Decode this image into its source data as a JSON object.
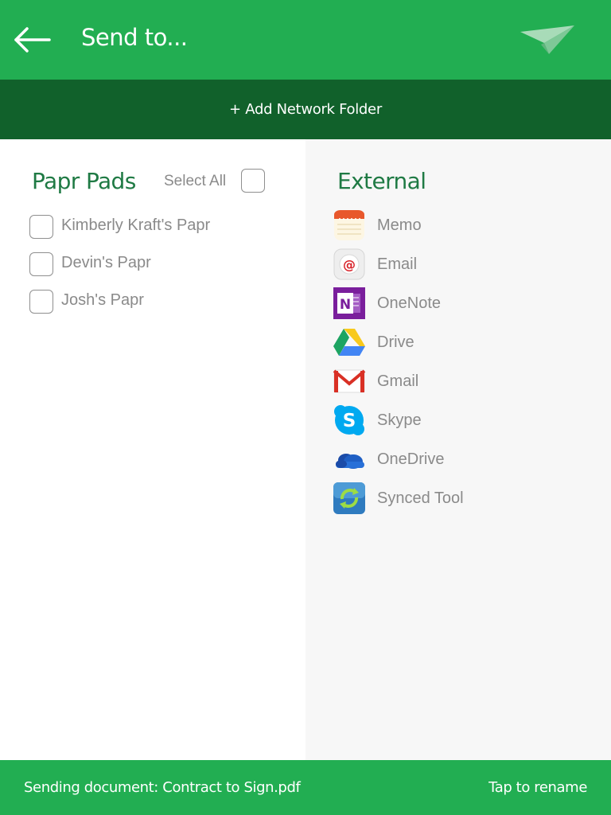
{
  "header": {
    "title": "Send to...",
    "back_icon": "arrow-left-icon",
    "send_icon": "paper-plane-icon",
    "bg_color": "#22ae52"
  },
  "add_network_folder": {
    "label": "+ Add Network Folder",
    "bg_color": "#11612b"
  },
  "papr_pads": {
    "title": "Papr Pads",
    "select_all_label": "Select All",
    "select_all_checked": false,
    "items": [
      {
        "label": "Kimberly Kraft's Papr",
        "checked": false
      },
      {
        "label": "Devin's Papr",
        "checked": false
      },
      {
        "label": "Josh's Papr",
        "checked": false
      }
    ]
  },
  "external": {
    "title": "External",
    "items": [
      {
        "label": "Memo",
        "icon": "memo-notepad-icon"
      },
      {
        "label": "Email",
        "icon": "email-at-icon"
      },
      {
        "label": "OneNote",
        "icon": "onenote-icon"
      },
      {
        "label": "Drive",
        "icon": "google-drive-icon"
      },
      {
        "label": "Gmail",
        "icon": "gmail-icon"
      },
      {
        "label": "Skype",
        "icon": "skype-icon"
      },
      {
        "label": "OneDrive",
        "icon": "onedrive-cloud-icon"
      },
      {
        "label": "Synced Tool",
        "icon": "sync-arrows-icon"
      }
    ]
  },
  "footer": {
    "status": "Sending document: Contract to Sign.pdf",
    "rename_label": "Tap to rename"
  },
  "colors": {
    "accent_green": "#22ae52",
    "dark_green": "#11612b",
    "title_green": "#1f7a44",
    "muted_text": "#8a8a8a"
  }
}
